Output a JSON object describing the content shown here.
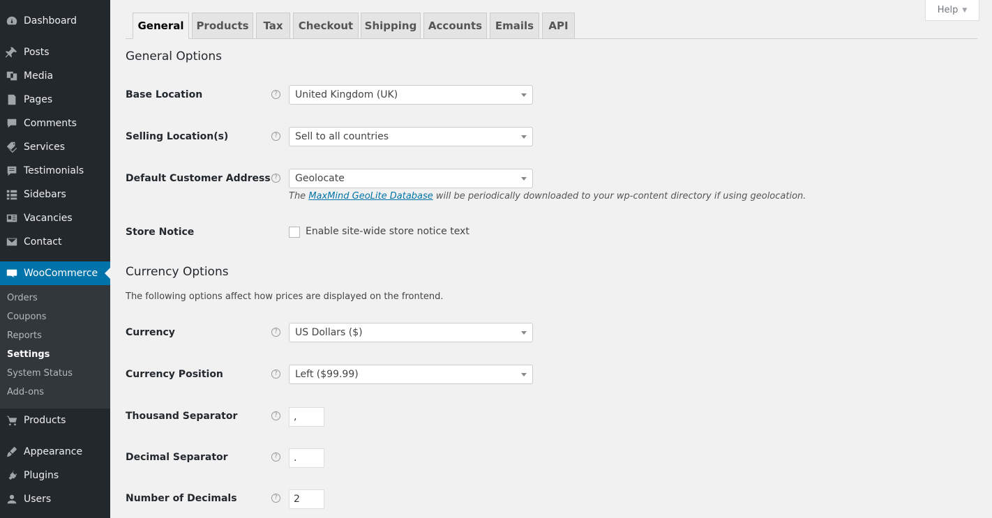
{
  "sidebar": {
    "items": [
      {
        "label": "Dashboard",
        "icon": "dashboard-icon"
      },
      {
        "label": "Posts",
        "icon": "pin-icon"
      },
      {
        "label": "Media",
        "icon": "media-icon"
      },
      {
        "label": "Pages",
        "icon": "page-icon"
      },
      {
        "label": "Comments",
        "icon": "comment-icon"
      },
      {
        "label": "Services",
        "icon": "tag-icon"
      },
      {
        "label": "Testimonials",
        "icon": "list-icon"
      },
      {
        "label": "Sidebars",
        "icon": "grid-icon"
      },
      {
        "label": "Vacancies",
        "icon": "id-card-icon"
      },
      {
        "label": "Contact",
        "icon": "mail-icon"
      },
      {
        "label": "WooCommerce",
        "icon": "woo-icon"
      },
      {
        "label": "Products",
        "icon": "cart-icon"
      },
      {
        "label": "Appearance",
        "icon": "brush-icon"
      },
      {
        "label": "Plugins",
        "icon": "plug-icon"
      },
      {
        "label": "Users",
        "icon": "user-icon"
      }
    ],
    "submenu": [
      "Orders",
      "Coupons",
      "Reports",
      "Settings",
      "System Status",
      "Add-ons"
    ],
    "active_color": "#0073aa"
  },
  "help": {
    "label": "Help"
  },
  "tabs": [
    "General",
    "Products",
    "Tax",
    "Checkout",
    "Shipping",
    "Accounts",
    "Emails",
    "API"
  ],
  "general": {
    "title": "General Options",
    "base_location": {
      "label": "Base Location",
      "value": "United Kingdom (UK)"
    },
    "selling_locations": {
      "label": "Selling Location(s)",
      "value": "Sell to all countries"
    },
    "default_address": {
      "label": "Default Customer Address",
      "value": "Geolocate"
    },
    "geo_desc": {
      "before": "The ",
      "link": "MaxMind GeoLite Database",
      "after": " will be periodically downloaded to your wp-content directory if using geolocation."
    },
    "store_notice": {
      "label": "Store Notice",
      "checkbox_label": "Enable site-wide store notice text"
    }
  },
  "currency": {
    "title": "Currency Options",
    "desc": "The following options affect how prices are displayed on the frontend.",
    "currency": {
      "label": "Currency",
      "value": "US Dollars ($)"
    },
    "position": {
      "label": "Currency Position",
      "value": "Left ($99.99)"
    },
    "thousand": {
      "label": "Thousand Separator",
      "value": ","
    },
    "decimal": {
      "label": "Decimal Separator",
      "value": "."
    },
    "decimals": {
      "label": "Number of Decimals",
      "value": "2"
    }
  },
  "tip_glyph": "?"
}
